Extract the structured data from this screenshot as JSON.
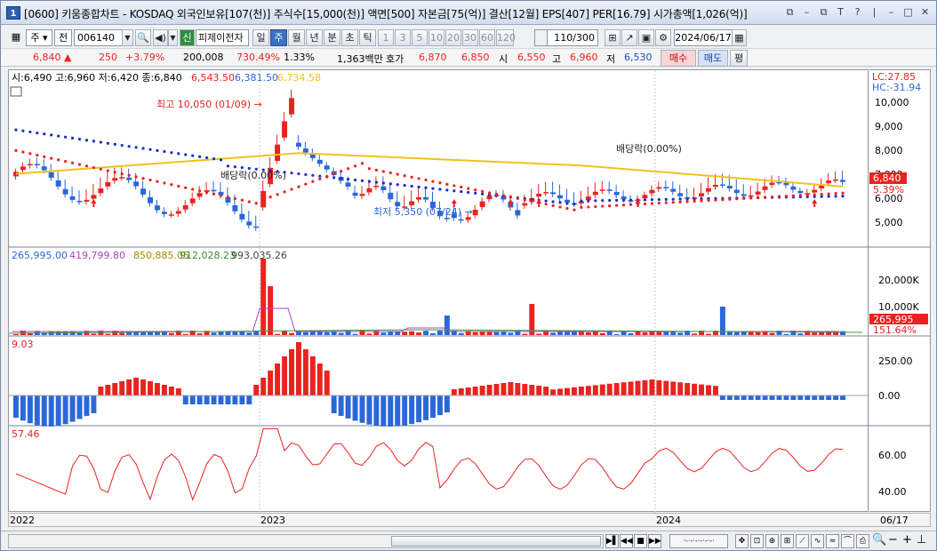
{
  "window": {
    "number": "1",
    "title": "[0600] 키움종합차트 - KOSDAQ 외국인보유[107(천)] 주식수[15,000(천)] 액면[500] 자본금[75(억)] 결산[12월] EPS[407] PER[16.79] 시가총액[1,026(억)]",
    "buttons": [
      "⧉",
      "–",
      "⧉",
      "T",
      "?",
      "|",
      "–",
      "□",
      "✕"
    ]
  },
  "toolbar": {
    "market": "주",
    "type": "전",
    "code": "006140",
    "name": "피제이전자",
    "periods": [
      "일",
      "주",
      "월",
      "년",
      "분",
      "초",
      "틱"
    ],
    "selected_period": "주",
    "intervals": [
      "1",
      "3",
      "5",
      "10",
      "20",
      "30",
      "60",
      "120"
    ],
    "count": "110/300",
    "date": "2024/06/17",
    "new_label": "신"
  },
  "quote": {
    "price": "6,840 ▲",
    "change": "250",
    "rate": "+3.79%",
    "volume": "200,008",
    "vol_rate": "730.49%",
    "turnover": "1.33%",
    "amount": "1,363백만",
    "ask_label": "호가",
    "ask1": "6,870",
    "ask2": "6,850",
    "open_label": "시",
    "open": "6,550",
    "high_label": "고",
    "high": "6,960",
    "low_label": "저",
    "low": "6,530",
    "buy": "매수",
    "sell": "매도",
    "eval": "평"
  },
  "panes": {
    "price": {
      "ohlc": "시:6,490 고:6,960 저:6,420 종:6,840",
      "ma1": "6,543.50",
      "ma2": "6,381.50",
      "ma3": "6,734.58",
      "lc": "LC:27.85",
      "hc": "HC:-31.94",
      "high_note": "최고 10,050 (01/09)",
      "low_note": "최저 5,350 (07/24)",
      "div1": "배당락(0.00%)",
      "div2": "배당락(0.00%)",
      "last_price": "6,840",
      "last_rate": "5.39%",
      "ticks": [
        "10,000",
        "9,000",
        "8,000",
        "7,000",
        "6,000",
        "5,000"
      ]
    },
    "volume": {
      "v1": "265,995.00",
      "v2": "419,799.80",
      "v3": "850,885.05",
      "v4": "912,028.23",
      "v5": "993,035.26",
      "ticks": [
        "20,000K",
        "10,000K"
      ],
      "last": "265,995",
      "last_rate": "151.64%"
    },
    "macd": {
      "value": "9.03",
      "ticks": [
        "250.00",
        "0.00"
      ]
    },
    "rsi": {
      "value": "57.46",
      "ticks": [
        "60.00",
        "40.00"
      ]
    }
  },
  "dates": [
    "2022",
    "2023",
    "2024",
    "06/17"
  ],
  "colors": {
    "up": "#e8231f",
    "down": "#2a68d8",
    "ma_gold": "#f2c21a",
    "blue_dot": "#1a2fc8"
  }
}
